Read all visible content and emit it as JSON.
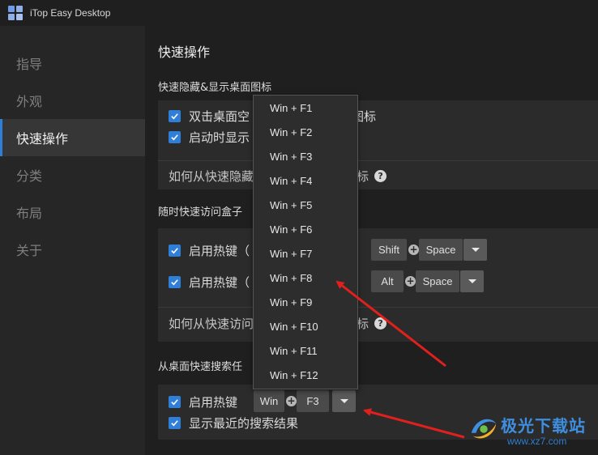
{
  "app": {
    "title": "iTop Easy Desktop"
  },
  "sidebar": {
    "items": [
      {
        "label": "指导"
      },
      {
        "label": "外观"
      },
      {
        "label": "快速操作",
        "active": true
      },
      {
        "label": "分类"
      },
      {
        "label": "布局"
      },
      {
        "label": "关于"
      }
    ]
  },
  "main": {
    "title": "快速操作",
    "sections": [
      {
        "title": "快速隐藏&显示桌面图标",
        "options": [
          {
            "label_before": "双击桌面空",
            "label_after": "图标",
            "checked": true
          },
          {
            "label": "启动时显示",
            "checked": true
          }
        ],
        "help": {
          "before": "如何从快速隐藏",
          "after": "标"
        }
      },
      {
        "title": "随时快速访问盒子",
        "hotkeys": [
          {
            "label": "启用热键（",
            "checked": true,
            "key2": "Shift",
            "key3": "Space"
          },
          {
            "label": "启用热键（",
            "checked": true,
            "key2": "Alt",
            "key3": "Space"
          }
        ],
        "help": {
          "before": "如何从快速访问",
          "after": "标"
        }
      },
      {
        "title": "从桌面快速搜索任",
        "hotkey": {
          "label": "启用热键",
          "checked": true,
          "key1": "Win",
          "key2": "F3"
        },
        "recent": {
          "label": "显示最近的搜索结果",
          "checked": true
        }
      }
    ]
  },
  "dropdown": {
    "items": [
      {
        "label": "Win + F1"
      },
      {
        "label": "Win + F2"
      },
      {
        "label": "Win + F3"
      },
      {
        "label": "Win + F4"
      },
      {
        "label": "Win + F5"
      },
      {
        "label": "Win + F6"
      },
      {
        "label": "Win + F7"
      },
      {
        "label": "Win + F8"
      },
      {
        "label": "Win + F9"
      },
      {
        "label": "Win + F10"
      },
      {
        "label": "Win + F11"
      },
      {
        "label": "Win + F12"
      }
    ]
  },
  "watermark": {
    "name": "极光下载站",
    "url": "www.xz7.com"
  },
  "colors": {
    "accent": "#2f7fd8",
    "annotation": "#e0201c",
    "background": "#1f1f1f"
  }
}
